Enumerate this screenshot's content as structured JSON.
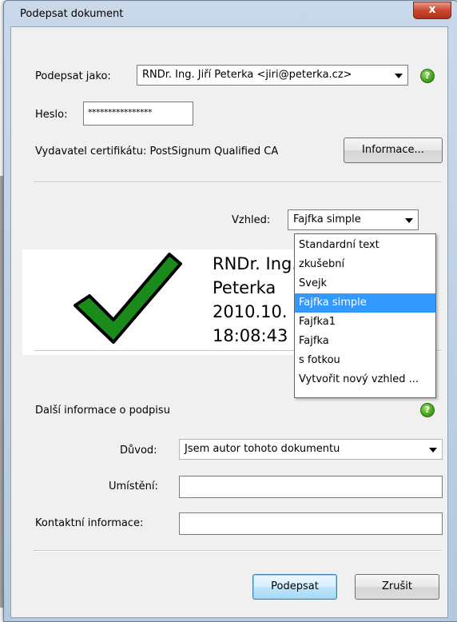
{
  "window": {
    "title": "Podepsat dokument",
    "close_label": "x"
  },
  "sign_as": {
    "label": "Podepsat jako:",
    "value": "RNDr. Ing. Jiří Peterka <jiri@peterka.cz>",
    "help": "?"
  },
  "password": {
    "label": "Heslo:",
    "value": "****************"
  },
  "issuer": {
    "label": "Vydavatel certifikátu: PostSignum Qualified CA",
    "info_button": "Informace..."
  },
  "appearance": {
    "label": "Vzhled:",
    "value": "Fajfka simple",
    "options": [
      "Standardní text",
      "zkušební",
      "Svejk",
      "Fajfka simple",
      "Fajfka1",
      "Fajfka",
      "s fotkou",
      "Vytvořit nový vzhled ..."
    ],
    "selected_index": 3
  },
  "preview": {
    "lines": [
      "RNDr. Ing.",
      "Peterka",
      "2010.10.",
      "18:08:43"
    ],
    "check_color": "#1a8a1a"
  },
  "more_info": {
    "label": "Další informace o podpisu",
    "help": "?",
    "reason_label": "Důvod:",
    "reason_value": "Jsem autor tohoto dokumentu",
    "location_label": "Umístění:",
    "location_value": "",
    "contact_label": "Kontaktní informace:",
    "contact_value": ""
  },
  "buttons": {
    "sign": "Podepsat",
    "cancel": "Zrušit"
  },
  "colors": {
    "selection": "#3399ff",
    "help_green": "#4ba521"
  }
}
